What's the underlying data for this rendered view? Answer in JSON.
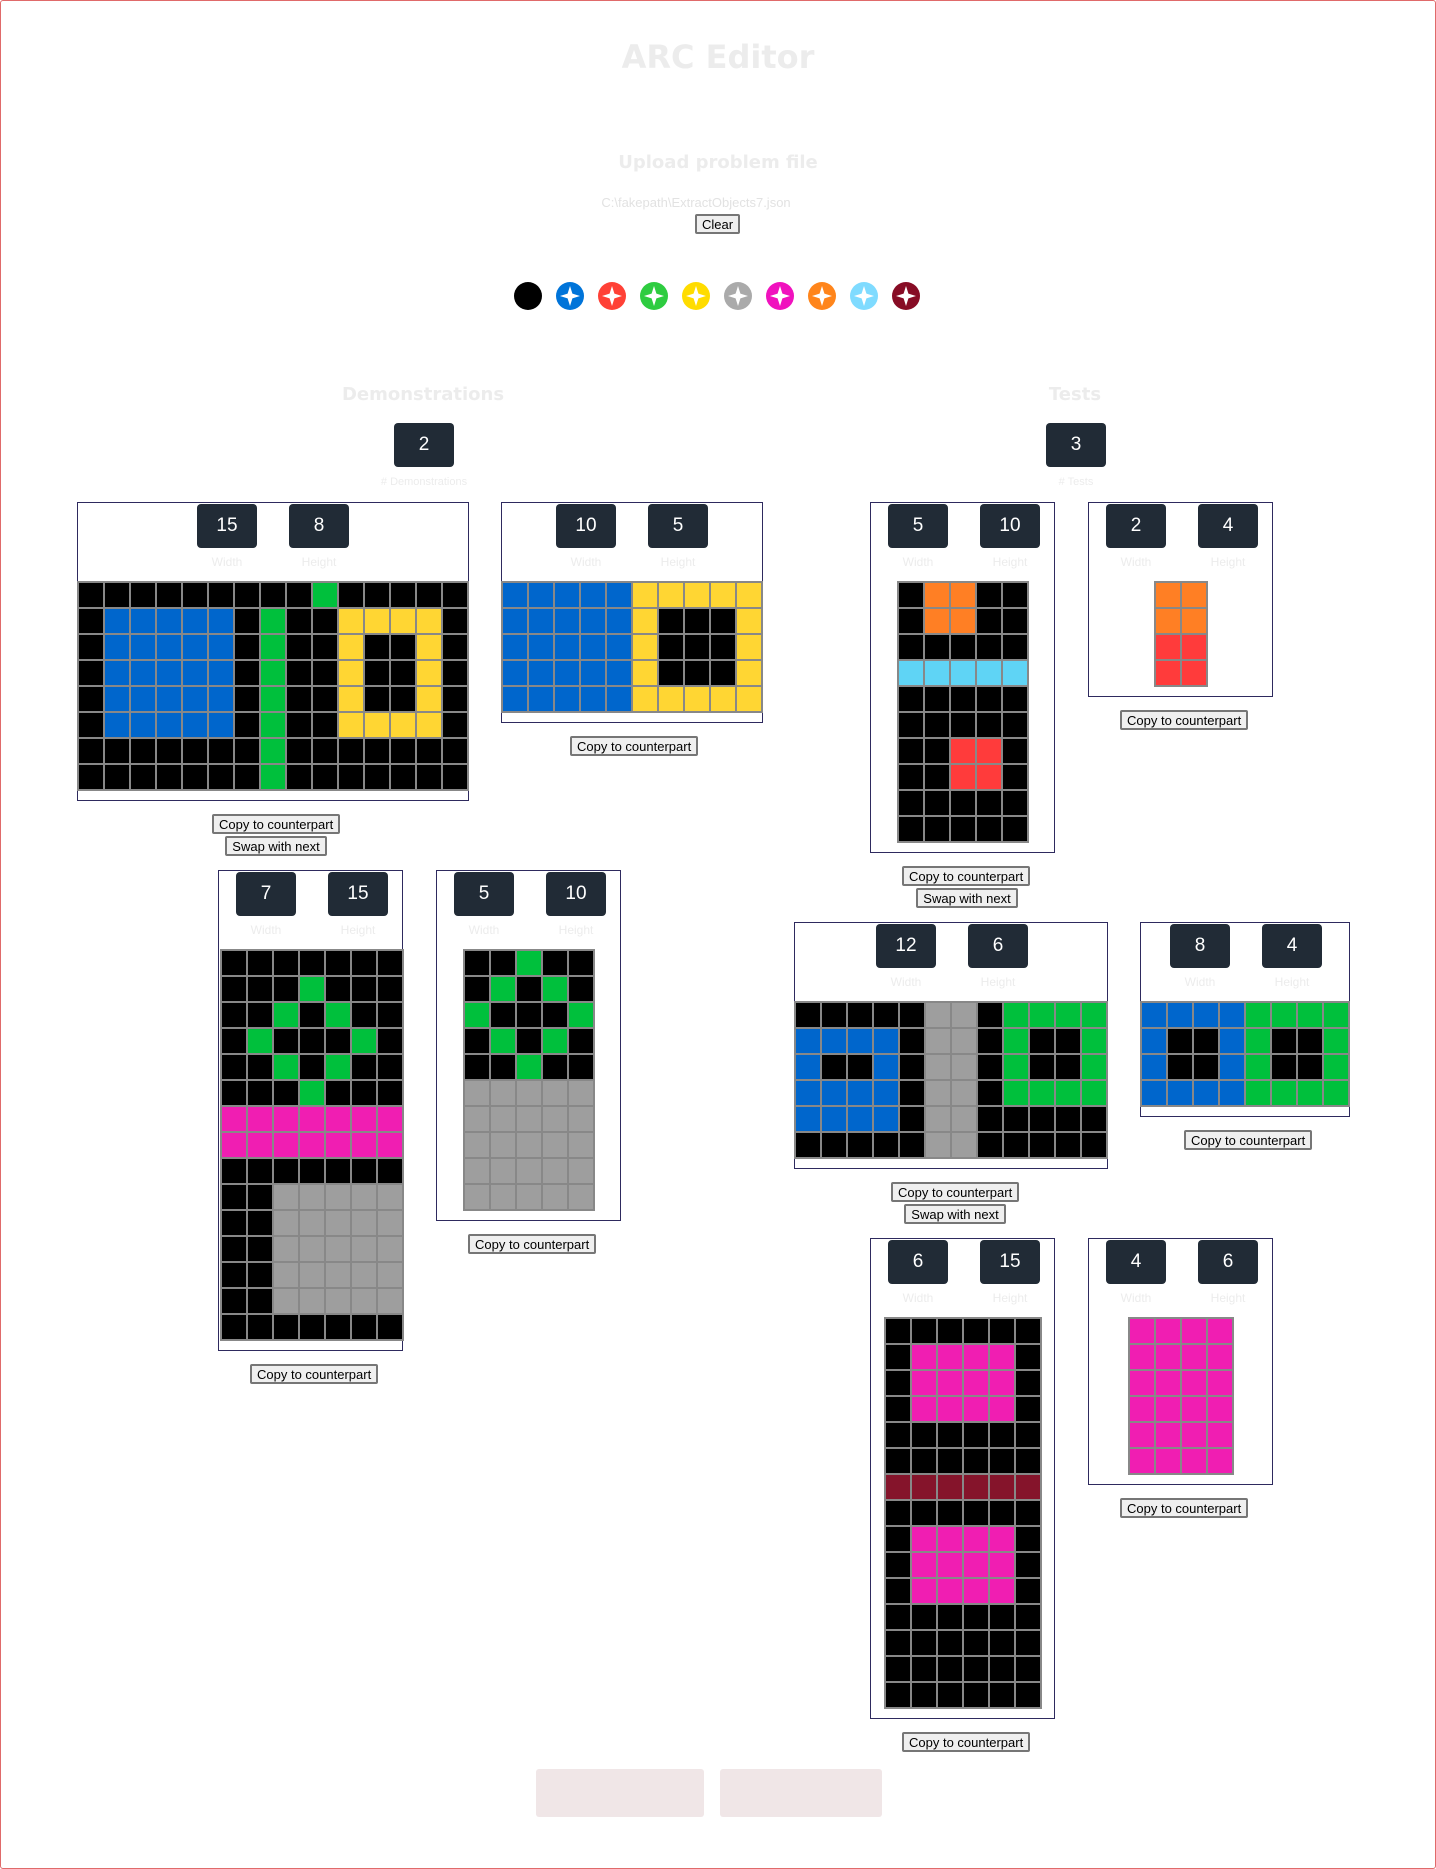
{
  "app": {
    "title": "ARC Editor"
  },
  "upload": {
    "heading": "Upload problem file",
    "file_path": "C:\\fakepath\\ExtractObjects7.json",
    "clear_label": "Clear"
  },
  "palette": {
    "colors": [
      "#000000",
      "#0074d9",
      "#ff4136",
      "#2ecc40",
      "#ffdc00",
      "#aaaaaa",
      "#f012be",
      "#ff851b",
      "#7fdbff",
      "#870c25"
    ],
    "selected_index": 0,
    "icon": "four-point-star-icon"
  },
  "cell_colors": {
    "0": "#000000",
    "1": "#0066cc",
    "2": "#ff3b3b",
    "3": "#00c03c",
    "4": "#ffd633",
    "5": "#9e9e9e",
    "6": "#f01eb2",
    "7": "#ff7f24",
    "8": "#5fd4f5",
    "9": "#85142b"
  },
  "demonstrations": {
    "heading": "Demonstrations",
    "count": "2",
    "count_label": "# Demonstrations",
    "pairs": [
      {
        "input": {
          "width": "15",
          "height": "8",
          "width_label": "Width",
          "height_label": "Height",
          "rows": [
            "000000000300000",
            "011111030044440",
            "011111030040040",
            "011111030040040",
            "011111030040040",
            "011111030044440",
            "000000030000000",
            "000000030000000"
          ]
        },
        "output": {
          "width": "10",
          "height": "5",
          "width_label": "Width",
          "height_label": "Height",
          "rows": [
            "1111144444",
            "1111140004",
            "1111140004",
            "1111140004",
            "1111144444"
          ]
        },
        "copy_input_label": "Copy to counterpart",
        "copy_output_label": "Copy to counterpart",
        "swap_label": "Swap with next"
      },
      {
        "input": {
          "width": "7",
          "height": "15",
          "width_label": "Width",
          "height_label": "Height",
          "rows": [
            "0000000",
            "0003000",
            "0030300",
            "0300030",
            "0030300",
            "0003000",
            "6666666",
            "6666666",
            "0000000",
            "0055555",
            "0055555",
            "0055555",
            "0055555",
            "0055555",
            "0000000"
          ]
        },
        "output": {
          "width": "5",
          "height": "10",
          "width_label": "Width",
          "height_label": "Height",
          "rows": [
            "00300",
            "03030",
            "30003",
            "03030",
            "00300",
            "55555",
            "55555",
            "55555",
            "55555",
            "55555"
          ]
        },
        "copy_input_label": "Copy to counterpart",
        "copy_output_label": "Copy to counterpart"
      }
    ]
  },
  "tests": {
    "heading": "Tests",
    "count": "3",
    "count_label": "# Tests",
    "pairs": [
      {
        "input": {
          "width": "5",
          "height": "10",
          "width_label": "Width",
          "height_label": "Height",
          "rows": [
            "07700",
            "07700",
            "00000",
            "88888",
            "00000",
            "00000",
            "00220",
            "00220",
            "00000",
            "00000"
          ]
        },
        "output": {
          "width": "2",
          "height": "4",
          "width_label": "Width",
          "height_label": "Height",
          "rows": [
            "77",
            "77",
            "22",
            "22"
          ]
        },
        "copy_input_label": "Copy to counterpart",
        "copy_output_label": "Copy to counterpart",
        "swap_label": "Swap with next"
      },
      {
        "input": {
          "width": "12",
          "height": "6",
          "width_label": "Width",
          "height_label": "Height",
          "rows": [
            "000005503333",
            "111105503003",
            "100105503003",
            "111105503333",
            "111105500000",
            "000005500000"
          ]
        },
        "output": {
          "width": "8",
          "height": "4",
          "width_label": "Width",
          "height_label": "Height",
          "rows": [
            "11113333",
            "10013003",
            "10013003",
            "11113333"
          ]
        },
        "copy_input_label": "Copy to counterpart",
        "copy_output_label": "Copy to counterpart",
        "swap_label": "Swap with next"
      },
      {
        "input": {
          "width": "6",
          "height": "15",
          "width_label": "Width",
          "height_label": "Height",
          "rows": [
            "000000",
            "066660",
            "066660",
            "066660",
            "000000",
            "000000",
            "999999",
            "000000",
            "066660",
            "066660",
            "066660",
            "000000",
            "000000",
            "000000",
            "000000"
          ]
        },
        "output": {
          "width": "4",
          "height": "6",
          "width_label": "Width",
          "height_label": "Height",
          "rows": [
            "6666",
            "6666",
            "6666",
            "6666",
            "6666",
            "6666"
          ]
        },
        "copy_input_label": "Copy to counterpart",
        "copy_output_label": "Copy to counterpart"
      }
    ]
  }
}
